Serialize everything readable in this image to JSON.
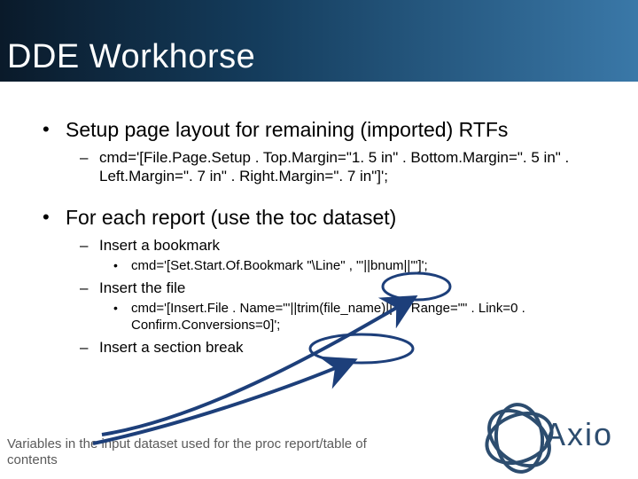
{
  "title": "DDE Workhorse",
  "bullets": [
    {
      "text": "Setup page layout for remaining (imported) RTFs",
      "sub": [
        {
          "text": "cmd='[File.Page.Setup . Top.Margin=\"1. 5 in\" . Bottom.Margin=\". 5 in\" . Left.Margin=\". 7 in\" . Right.Margin=\". 7 in\"]';"
        }
      ]
    },
    {
      "text": "For each report (use the toc dataset)",
      "sub": [
        {
          "text": "Insert a bookmark",
          "detail": "cmd='[Set.Start.Of.Bookmark \"\\Line\" , \"'||bnum||'\"]';"
        },
        {
          "text": "Insert the file",
          "detail": "cmd='[Insert.File . Name=\"'||trim(file_name)||'\" . Range=\"\" . Link=0 . Confirm.Conversions=0]';"
        },
        {
          "text": "Insert a section break"
        }
      ]
    }
  ],
  "caption": "Variables in the input dataset used for the proc report/table of contents",
  "logo": {
    "text": "xio",
    "first": "A"
  }
}
